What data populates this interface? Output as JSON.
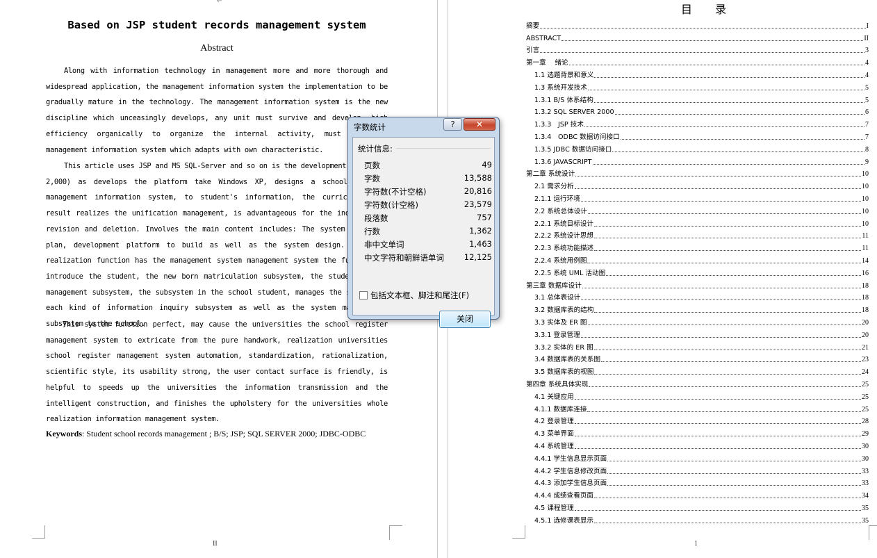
{
  "left_page": {
    "title": "Based on JSP student records management system",
    "abstract_heading": "Abstract",
    "paragraphs": [
      "Along with information technology in management more and more thorough and widespread application, the management information system the implementation to be gradually mature in the technology. The management information system is the new discipline which unceasingly develops, any unit must survive and develop, high efficiency organically to organize the internal activity, must establish management information system which adapts with own characteristic.",
      "This article uses JSP and MS SQL-Server and so on is the development kit, (SQL 2,000) as develops the platform take Windows XP, designs a school register management information system, to student's information, the curriculum, the result realizes the unification management, is advantageous for the inquiry, the revision and deletion. Involves the main content includes: The system structure plan, development platform to build as well as the system design. The main realization function has the management system management system the function to introduce the student, the new born matriculation subsystem, the student result management subsystem, the subsystem in the school student, manages the subsystem, each kind of information inquiry subsystem as well as the system maintenance subsystem to the school.",
      "This system function perfect, may cause the universities the school register management system to extricate from the pure handwork, realization universities school register management system automation, standardization, rationalization, scientific style, its usability strong, the user contact surface is friendly, is helpful to speeds up the universities the information transmission and the intelligent construction, and finishes the upholstery for the universities whole realization information management system."
    ],
    "keywords_label": "Keywords",
    "keywords_text": ": Student school records management ; B/S; JSP; SQL SERVER 2000; JDBC-ODBC",
    "page_number": "II"
  },
  "right_page": {
    "toc_title": "目  录",
    "page_number": "1",
    "toc": [
      {
        "label": "摘要",
        "page": "I",
        "indent": 0
      },
      {
        "label": "ABSTRACT",
        "page": "II",
        "indent": 0
      },
      {
        "label": "引言",
        "page": "3",
        "indent": 0
      },
      {
        "label": "第一章　 绪论",
        "page": "4",
        "indent": 0
      },
      {
        "label": "1.1 选题背景和意义",
        "page": "4",
        "indent": 1
      },
      {
        "label": "1.3 系统开发技术",
        "page": "5",
        "indent": 1
      },
      {
        "label": "1.3.1 B/S 体系结构",
        "page": "5",
        "indent": 1
      },
      {
        "label": "1.3.2 SQL SERVER 2000",
        "page": "6",
        "indent": 1
      },
      {
        "label": "1.3.3　JSP 技术",
        "page": "7",
        "indent": 1
      },
      {
        "label": "1.3.4　ODBC 数据访问接口",
        "page": "7",
        "indent": 1
      },
      {
        "label": "1.3.5 JDBC 数据访问接口",
        "page": "8",
        "indent": 1
      },
      {
        "label": "1.3.6 JAVASCRIPT",
        "page": "9",
        "indent": 1
      },
      {
        "label": "第二章 系统设计",
        "page": "10",
        "indent": 0
      },
      {
        "label": "2.1 需求分析",
        "page": "10",
        "indent": 1
      },
      {
        "label": "2.1.1 运行环境",
        "page": "10",
        "indent": 1
      },
      {
        "label": "2.2 系统总体设计",
        "page": "10",
        "indent": 1
      },
      {
        "label": "2.2.1 系统目标设计",
        "page": "10",
        "indent": 1
      },
      {
        "label": "2.2.2 系统设计思想",
        "page": "11",
        "indent": 1
      },
      {
        "label": "2.2.3 系统功能描述",
        "page": "11",
        "indent": 1
      },
      {
        "label": "2.2.4 系统用例图",
        "page": "14",
        "indent": 1
      },
      {
        "label": "2.2.5 系统 UML 活动图",
        "page": "16",
        "indent": 1
      },
      {
        "label": "第三章 数据库设计",
        "page": "18",
        "indent": 0
      },
      {
        "label": "3.1 总体表设计",
        "page": "18",
        "indent": 1
      },
      {
        "label": "3.2 数据库表的结构",
        "page": "18",
        "indent": 1
      },
      {
        "label": "3.3 实体及 ER 图",
        "page": "20",
        "indent": 1
      },
      {
        "label": "3.3.1 登录管理",
        "page": "20",
        "indent": 1
      },
      {
        "label": "3.3.2 实体的 ER 图",
        "page": "21",
        "indent": 1
      },
      {
        "label": "3.4 数据库表的关系图",
        "page": "23",
        "indent": 1
      },
      {
        "label": "3.5 数据库表的视图",
        "page": "24",
        "indent": 1
      },
      {
        "label": "第四章 系统具体实现",
        "page": "25",
        "indent": 0
      },
      {
        "label": "4.1 关键应用",
        "page": "25",
        "indent": 1
      },
      {
        "label": "4.1.1 数据库连接",
        "page": "25",
        "indent": 1
      },
      {
        "label": "4.2 登录管理",
        "page": "28",
        "indent": 1
      },
      {
        "label": "4.3 菜单界面",
        "page": "29",
        "indent": 1
      },
      {
        "label": "4.4 系统管理",
        "page": "30",
        "indent": 1
      },
      {
        "label": "4.4.1 学生信息显示页面",
        "page": "30",
        "indent": 1
      },
      {
        "label": "4.4.2 学生信息修改页面",
        "page": "33",
        "indent": 1
      },
      {
        "label": "4.4.3 添加学生信息页面",
        "page": "33",
        "indent": 1
      },
      {
        "label": "4.4.4 成绩查看页面",
        "page": "34",
        "indent": 1
      },
      {
        "label": "4.5 课程管理",
        "page": "35",
        "indent": 1
      },
      {
        "label": "4.5.1 选修课表显示",
        "page": "35",
        "indent": 1
      }
    ]
  },
  "dialog": {
    "title": "字数统计",
    "help_glyph": "?",
    "close_glyph": "✕",
    "group_label": "统计信息:",
    "stats": [
      {
        "label": "页数",
        "value": "49"
      },
      {
        "label": "字数",
        "value": "13,588"
      },
      {
        "label": "字符数(不计空格)",
        "value": "20,816"
      },
      {
        "label": "字符数(计空格)",
        "value": "23,579"
      },
      {
        "label": "段落数",
        "value": "757"
      },
      {
        "label": "行数",
        "value": "1,362"
      },
      {
        "label": "非中文单词",
        "value": "1,463"
      },
      {
        "label": "中文字符和朝鲜语单词",
        "value": "12,125"
      }
    ],
    "checkbox_label": "包括文本框、脚注和尾注(F)",
    "checkbox_checked": false,
    "close_button": "关闭"
  }
}
